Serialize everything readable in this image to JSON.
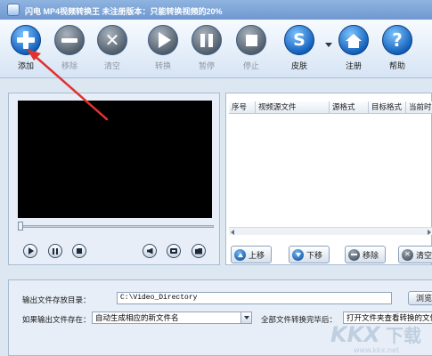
{
  "window": {
    "title": "闪电 MP4视频转换王   未注册版本：只能转换视频的20%"
  },
  "toolbar": {
    "buttons": [
      {
        "label": "添加",
        "icon": "plus-icon",
        "enabled": true
      },
      {
        "label": "移除",
        "icon": "minus-icon",
        "enabled": false
      },
      {
        "label": "清空",
        "icon": "close-icon",
        "enabled": false
      },
      {
        "label": "转换",
        "icon": "play-icon",
        "enabled": false
      },
      {
        "label": "暂停",
        "icon": "pause-icon",
        "enabled": false
      },
      {
        "label": "停止",
        "icon": "stop-icon",
        "enabled": false
      },
      {
        "label": "皮肤",
        "icon": "skin-icon",
        "enabled": true
      },
      {
        "label": "注册",
        "icon": "home-icon",
        "enabled": true
      },
      {
        "label": "帮助",
        "icon": "help-icon",
        "enabled": true
      }
    ]
  },
  "file_list": {
    "columns": [
      "序号",
      "视频源文件",
      "源格式",
      "目标格式",
      "当前时间"
    ],
    "rows": []
  },
  "list_actions": {
    "move_up": "上移",
    "move_down": "下移",
    "remove": "移除",
    "clear": "清空"
  },
  "output": {
    "dir_label": "输出文件存放目录：",
    "dir_value": "C:\\Video_Directory",
    "browse_label": "浏览",
    "exists_label": "如果输出文件存在：",
    "exists_value": "自动生成相应的新文件名",
    "after_label": "全部文件转换完毕后：",
    "after_value": "打开文件夹查看转换的文件"
  },
  "watermark": {
    "text": "KKX下载",
    "url": "www.kkx.net"
  },
  "colors": {
    "title_bar": "#6f98cf",
    "accent_blue": "#0d5bb8",
    "disabled_gray": "#4e5a67",
    "annotation_arrow": "#e0332f"
  }
}
